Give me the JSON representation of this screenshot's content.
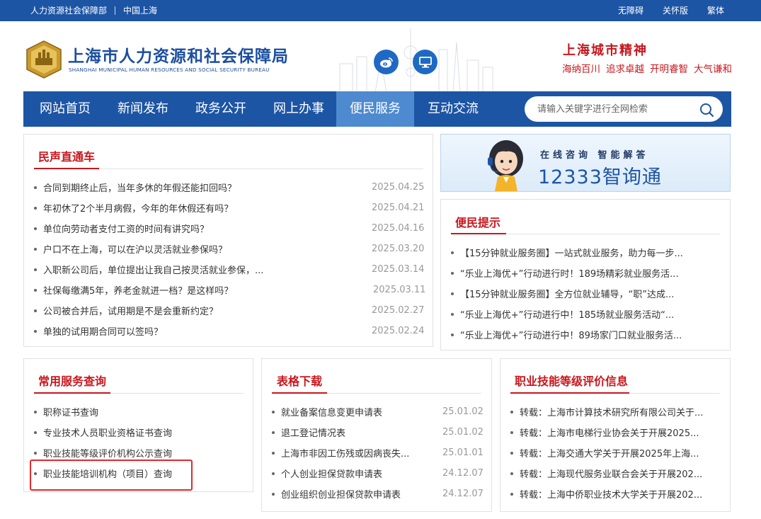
{
  "topbar": {
    "left": [
      "人力资源社会保障部",
      "中国上海"
    ],
    "right": [
      "无障碍",
      "关怀版",
      "繁体"
    ]
  },
  "header": {
    "title": "上海市人力资源和社会保障局",
    "subtitle": "SHANGHAI MUNICIPAL HUMAN RESOURCES AND SOCIAL SECURITY BUREAU",
    "spirit_title": "上海城市精神",
    "spirit_words": [
      "海纳百川",
      "追求卓越",
      "开明睿智",
      "大气谦和"
    ]
  },
  "nav": {
    "items": [
      "网站首页",
      "新闻发布",
      "政务公开",
      "网上办事",
      "便民服务",
      "互动交流"
    ],
    "active": "便民服务",
    "search_placeholder": "请输入关键字进行全网检索"
  },
  "mingsheng": {
    "title": "民声直通车",
    "items": [
      {
        "text": "合同到期终止后，当年多休的年假还能扣回吗？",
        "date": "2025.04.25"
      },
      {
        "text": "年初休了2个半月病假，今年的年休假还有吗？",
        "date": "2025.04.21"
      },
      {
        "text": "单位向劳动者支付工资的时间有讲究吗？",
        "date": "2025.04.16"
      },
      {
        "text": "户口不在上海，可以在沪以灵活就业参保吗？",
        "date": "2025.03.20"
      },
      {
        "text": "入职新公司后，单位提出让我自己按灵活就业参保，...",
        "date": "2025.03.14"
      },
      {
        "text": "社保每缴满5年，养老金就进一档？是这样吗？",
        "date": "2025.03.11"
      },
      {
        "text": "公司被合并后，试用期是不是会重新约定？",
        "date": "2025.02.27"
      },
      {
        "text": "单独的试用期合同可以签吗？",
        "date": "2025.02.24"
      }
    ]
  },
  "banner": {
    "line1": "在线咨询  智能解答",
    "line2": "12333智询通"
  },
  "tips": {
    "title": "便民提示",
    "items": [
      "【15分钟就业服务圈】一站式就业服务，助力每一步...",
      "“乐业上海优+”行动进行时！189场精彩就业服务活...",
      "【15分钟就业服务圈】全方位就业辅导，“职”达成...",
      "“乐业上海优+”行动进行中！185场就业服务活动“...",
      "“乐业上海优+”行动进行中！89场家门口就业服务活..."
    ]
  },
  "common": {
    "title": "常用服务查询",
    "items": [
      "职称证书查询",
      "专业技术人员职业资格证书查询",
      "职业技能等级评价机构公示查询",
      "职业技能培训机构（项目）查询"
    ]
  },
  "forms": {
    "title": "表格下载",
    "items": [
      {
        "text": "就业备案信息变更申请表",
        "date": "25.01.02"
      },
      {
        "text": "退工登记情况表",
        "date": "25.01.02"
      },
      {
        "text": "上海市非因工伤残或因病丧失...",
        "date": "25.01.01"
      },
      {
        "text": "个人创业担保贷款申请表",
        "date": "24.12.07"
      },
      {
        "text": "创业组织创业担保贷款申请表",
        "date": "24.12.07"
      }
    ]
  },
  "skills": {
    "title": "职业技能等级评价信息",
    "items": [
      "转载：上海市计算技术研究所有限公司关于...",
      "转载：上海市电梯行业协会关于开展2025...",
      "转载：上海交通大学关于开展2025年上海...",
      "转载：上海现代服务业联合会关于开展202...",
      "转载：上海中侨职业技术大学关于开展202..."
    ]
  },
  "colors": {
    "brand_blue": "#1d55a5",
    "nav_active": "#4d8ad0",
    "accent_red": "#c8161d"
  }
}
